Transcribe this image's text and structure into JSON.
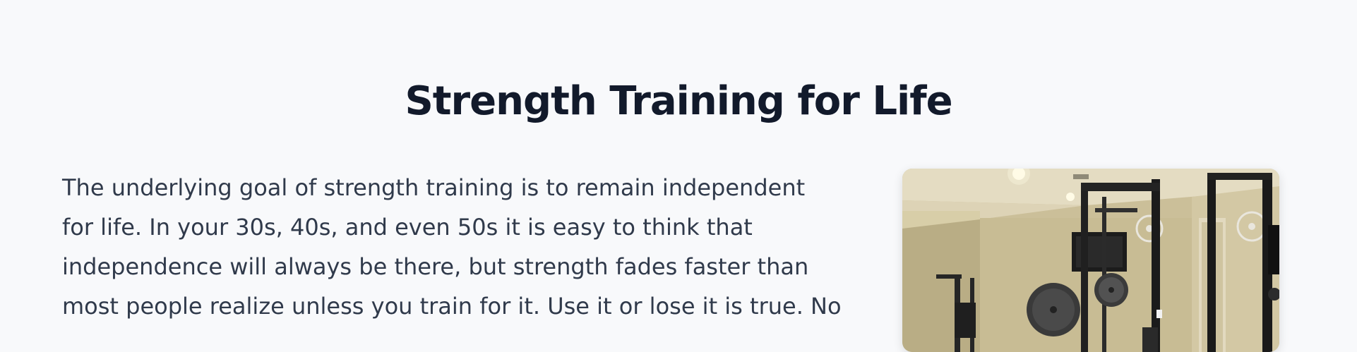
{
  "section": {
    "title": "Strength Training for Life",
    "body_lines": [
      "The underlying goal of strength training is to remain independent",
      "for life. In your 30s, 40s, and even 50s it is easy to think that",
      "independence will always be there, but strength fades faster than",
      "most people realize unless you train for it. Use it or lose it is true. No"
    ]
  },
  "photo": {
    "subject": "home-gym-basement-photo"
  }
}
